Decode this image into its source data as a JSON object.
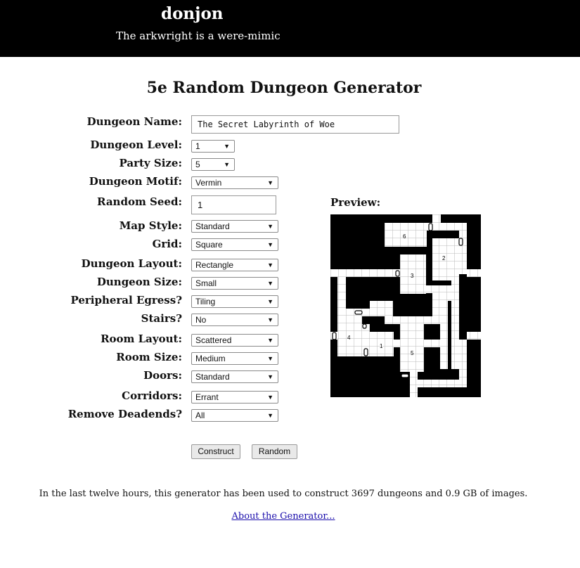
{
  "site": {
    "title": "donjon",
    "tagline": "The arkwright is a were-mimic"
  },
  "page_title": "5e Random Dungeon Generator",
  "form": {
    "dungeon_name": {
      "label": "Dungeon Name:",
      "value": "The Secret Labyrinth of Woe"
    },
    "dungeon_level": {
      "label": "Dungeon Level:",
      "value": "1"
    },
    "party_size": {
      "label": "Party Size:",
      "value": "5"
    },
    "dungeon_motif": {
      "label": "Dungeon Motif:",
      "value": "Vermin"
    },
    "random_seed": {
      "label": "Random Seed:",
      "value": "1"
    },
    "map_style": {
      "label": "Map Style:",
      "value": "Standard"
    },
    "grid": {
      "label": "Grid:",
      "value": "Square"
    },
    "dungeon_layout": {
      "label": "Dungeon Layout:",
      "value": "Rectangle"
    },
    "dungeon_size": {
      "label": "Dungeon Size:",
      "value": "Small"
    },
    "peripheral_egress": {
      "label": "Peripheral Egress?",
      "value": "Tiling"
    },
    "stairs": {
      "label": "Stairs?",
      "value": "No"
    },
    "room_layout": {
      "label": "Room Layout:",
      "value": "Scattered"
    },
    "room_size": {
      "label": "Room Size:",
      "value": "Medium"
    },
    "doors": {
      "label": "Doors:",
      "value": "Standard"
    },
    "corridors": {
      "label": "Corridors:",
      "value": "Errant"
    },
    "remove_deadends": {
      "label": "Remove Deadends?",
      "value": "All"
    }
  },
  "buttons": {
    "construct": "Construct",
    "random": "Random"
  },
  "preview": {
    "label": "Preview:",
    "room_numbers": [
      "1",
      "2",
      "3",
      "4",
      "5",
      "6"
    ]
  },
  "footer": {
    "stats": "In the last twelve hours, this generator has been used to construct 3697 dungeons and 0.9 GB of images.",
    "about_link": "About the Generator..."
  },
  "colors": {
    "header_bg": "#000000",
    "link": "#1a0dab",
    "map_floor": "#ffffff",
    "map_wall": "#000000"
  }
}
